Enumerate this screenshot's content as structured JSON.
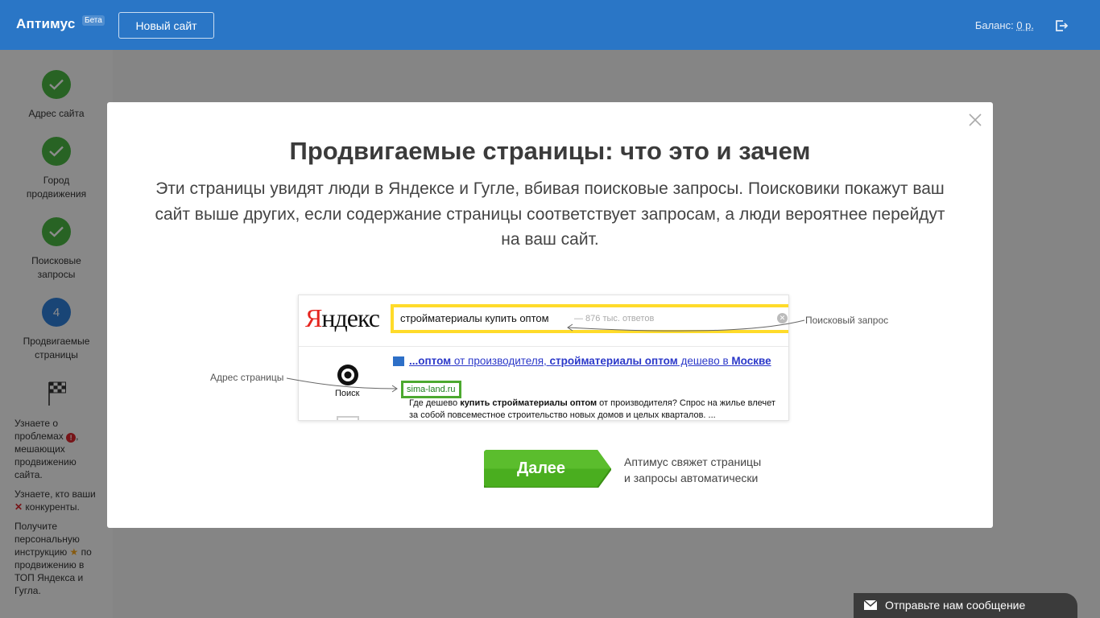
{
  "header": {
    "logo": "Аптимус",
    "beta": "Бета",
    "new_site_button": "Новый сайт",
    "balance_label": "Баланс:",
    "balance_value": "0 р.",
    "accent_color": "#2a76c6"
  },
  "sidebar": {
    "steps": [
      {
        "label": "Адрес сайта",
        "status": "done"
      },
      {
        "label": "Город продвижения",
        "status": "done"
      },
      {
        "label": "Поисковые запросы",
        "status": "done"
      },
      {
        "number": "4",
        "label": "Продвигаемые страницы",
        "status": "active"
      }
    ],
    "notes": {
      "problems_pre": "Узнаете о проблемах",
      "problems_post": ", мешающих продвижению сайта.",
      "competitors_pre": "Узнаете, кто ваши",
      "competitors_post": "конкуренты.",
      "instruction_pre": "Получите персональную инструкцию",
      "instruction_post": "по продвижению в ТОП Яндекса и Гугла."
    }
  },
  "modal": {
    "title": "Продвигаемые страницы: что это и зачем",
    "description": "Эти страницы увидят люди в Яндексе и Гугле, вбивая поисковые запросы. Поисковики покажут ваш сайт выше других, если содержание страницы соответствует запросам, а люди вероятнее перейдут на ваш сайт.",
    "illustration": {
      "yandex_ya": "Я",
      "yandex_rest": "ндекс",
      "search_query": "стройматериалы купить оптом",
      "search_count": "— 876 тыс. ответов",
      "search_label": "Поиск",
      "result_title_1": "...оптом",
      "result_title_2": " от производителя, ",
      "result_title_3": "стройматериалы оптом",
      "result_title_4": " дешево в ",
      "result_title_5": "Москве",
      "result_url": "sima-land.ru",
      "snippet_1": "Где дешево ",
      "snippet_2": "купить стройматериалы оптом",
      "snippet_3": " от производителя? Спрос на жилье влечет за собой повсеместное строительство новых домов и целых кварталов. ...",
      "callout_query": "Поисковый запрос",
      "callout_address": "Адрес страницы"
    },
    "next_button": "Далее",
    "next_note_1": "Аптимус свяжет страницы",
    "next_note_2": "и запросы автоматически"
  },
  "chat": {
    "label": "Отправьте нам сообщение"
  }
}
